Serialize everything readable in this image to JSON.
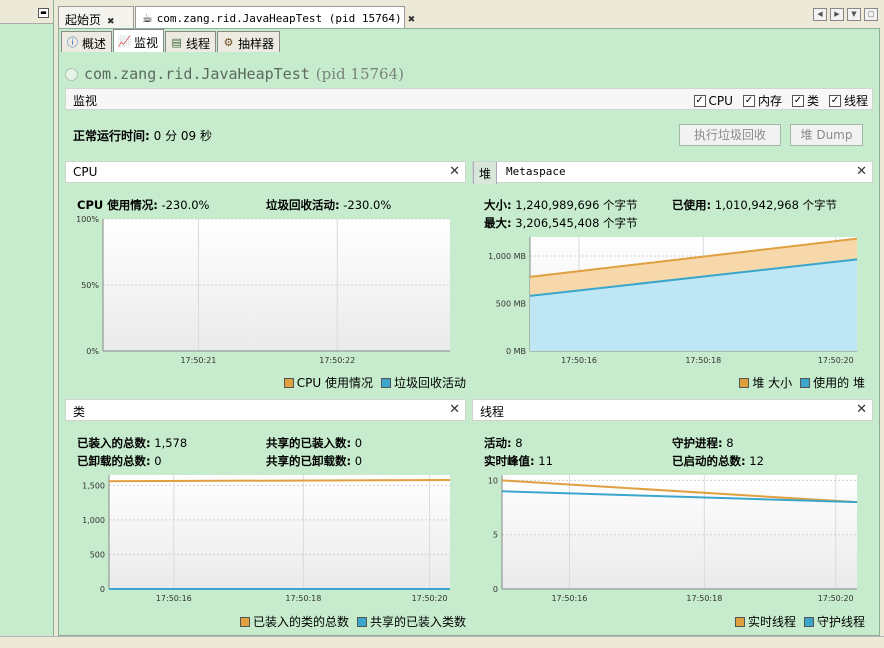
{
  "left_panel": {
    "minimize_glyph": "▬"
  },
  "tabs": [
    {
      "label": "起始页",
      "close": "✖"
    },
    {
      "label": "com.zang.rid.JavaHeapTest (pid 15764)",
      "close": "✖"
    }
  ],
  "nav": {
    "left": "◀",
    "right": "▶",
    "menu": "▼",
    "maximize": "□"
  },
  "subtabs": [
    {
      "label": "概述",
      "icon": "overview-icon"
    },
    {
      "label": "监视",
      "icon": "monitor-icon"
    },
    {
      "label": "线程",
      "icon": "threads-icon"
    },
    {
      "label": "抽样器",
      "icon": "sampler-icon"
    }
  ],
  "process": {
    "name": "com.zang.rid.JavaHeapTest",
    "pid": "(pid 15764)"
  },
  "monitor": {
    "title": "监视",
    "checks": [
      {
        "label": "CPU",
        "checked": true
      },
      {
        "label": "内存",
        "checked": true
      },
      {
        "label": "类",
        "checked": true
      },
      {
        "label": "线程",
        "checked": true
      }
    ],
    "uptime_label": "正常运行时间:",
    "uptime_value": "0 分 09 秒",
    "gc_button": "执行垃圾回收",
    "dump_button": "堆 Dump"
  },
  "close_glyph": "✕",
  "panels": {
    "cpu": {
      "title": "CPU",
      "stat1_label": "CPU 使用情况:",
      "stat1_value": "-230.0%",
      "stat2_label": "垃圾回收活动:",
      "stat2_value": "-230.0%",
      "legend": [
        "CPU 使用情况",
        "垃圾回收活动"
      ]
    },
    "heap": {
      "tab_heap": "堆",
      "tab_meta": "Metaspace",
      "size_label": "大小:",
      "size_value": "1,240,989,696 个字节",
      "used_label": "已使用:",
      "used_value": "1,010,942,968 个字节",
      "max_label": "最大:",
      "max_value": "3,206,545,408 个字节",
      "legend": [
        "堆 大小",
        "使用的 堆"
      ]
    },
    "classes": {
      "title": "类",
      "loaded_label": "已装入的总数:",
      "loaded_value": "1,578",
      "shared_loaded_label": "共享的已装入数:",
      "shared_loaded_value": "0",
      "unloaded_label": "已卸载的总数:",
      "unloaded_value": "0",
      "shared_unloaded_label": "共享的已卸载数:",
      "shared_unloaded_value": "0",
      "legend": [
        "已装入的类的总数",
        "共享的已装入类数"
      ]
    },
    "threads": {
      "title": "线程",
      "live_label": "活动:",
      "live_value": "8",
      "daemon_label": "守护进程:",
      "daemon_value": "8",
      "peak_label": "实时峰值:",
      "peak_value": "11",
      "started_label": "已启动的总数:",
      "started_value": "12",
      "legend": [
        "实时线程",
        "守护线程"
      ]
    }
  },
  "colors": {
    "orange": "#e0a040",
    "blue": "#3aa6cc",
    "orange_fill": "#f6d8aa",
    "blue_fill": "#bfe6f4"
  },
  "chart_data": [
    {
      "type": "line",
      "title": "CPU",
      "x": [
        "17:50:21",
        "17:50:22"
      ],
      "ylim": [
        0,
        100
      ],
      "yticks": [
        "0%",
        "50%",
        "100%"
      ],
      "series": [
        {
          "name": "CPU 使用情况",
          "values": []
        },
        {
          "name": "垃圾回收活动",
          "values": []
        }
      ]
    },
    {
      "type": "area",
      "title": "堆",
      "x": [
        "17:50:16",
        "17:50:18",
        "17:50:20"
      ],
      "ylim": [
        0,
        1200
      ],
      "yticks": [
        "0 MB",
        "500 MB",
        "1,000 MB"
      ],
      "series": [
        {
          "name": "堆 大小",
          "start": 780,
          "end": 1183
        },
        {
          "name": "使用的 堆",
          "start": 580,
          "end": 964
        }
      ]
    },
    {
      "type": "line",
      "title": "类",
      "x": [
        "17:50:16",
        "17:50:18",
        "17:50:20"
      ],
      "ylim": [
        0,
        1650
      ],
      "yticks": [
        "0",
        "500",
        "1,000",
        "1,500"
      ],
      "series": [
        {
          "name": "已装入的类的总数",
          "start": 1560,
          "end": 1578
        },
        {
          "name": "共享的已装入类数",
          "start": 0,
          "end": 0
        }
      ]
    },
    {
      "type": "line",
      "title": "线程",
      "x": [
        "17:50:16",
        "17:50:18",
        "17:50:20"
      ],
      "ylim": [
        0,
        10.5
      ],
      "yticks": [
        "0",
        "5",
        "10"
      ],
      "series": [
        {
          "name": "实时线程",
          "start": 10,
          "end": 8
        },
        {
          "name": "守护线程",
          "start": 9,
          "end": 8
        }
      ]
    }
  ]
}
